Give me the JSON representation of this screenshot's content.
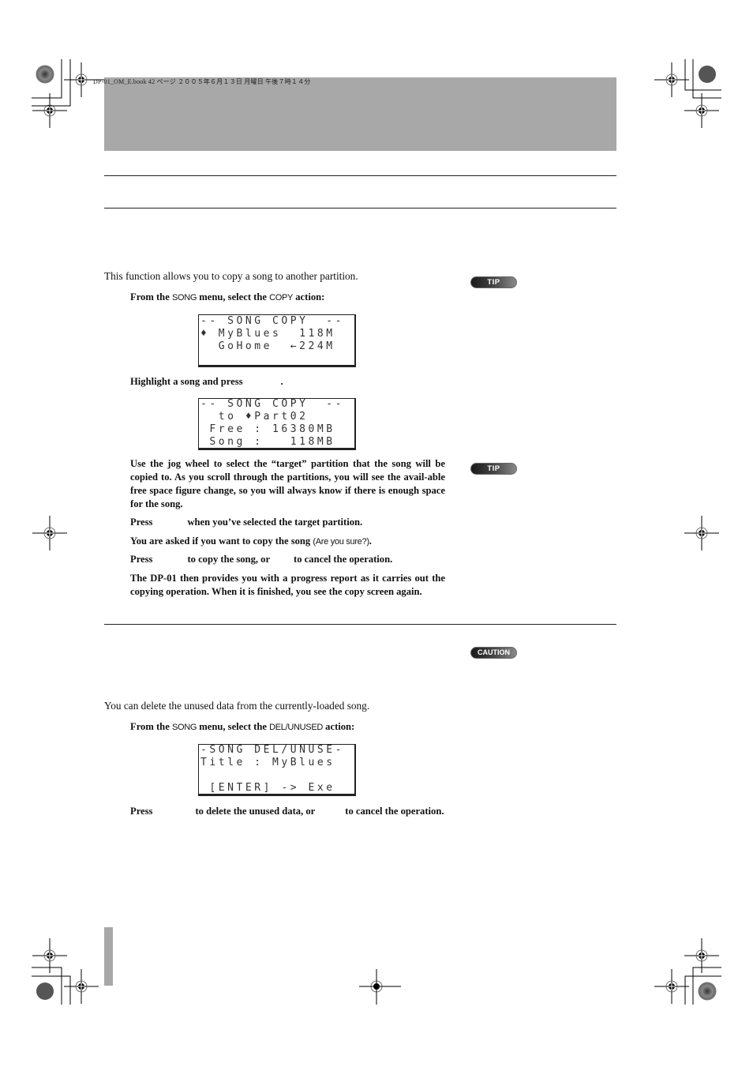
{
  "page": {
    "file_info": "DP-01_OM_E.book  42 ページ  ２００５年６月１３日  月曜日  午後７時１４分"
  },
  "badges": {
    "tip1": "TIP",
    "tip2": "TIP",
    "caution": "CAUTION"
  },
  "copy_section": {
    "intro": "This function allows you to copy a song to another partition.",
    "step1": {
      "pre": "From the ",
      "menu": "SONG",
      "mid": " menu, select the ",
      "action": "COPY",
      "post": " action:"
    },
    "lcd1": [
      "-- SONG COPY  --",
      "♦ MyBlues  118M",
      "  GoHome  ←224M"
    ],
    "step2": "Highlight a song and press",
    "step2_end": ".",
    "lcd2": [
      "-- SONG COPY  --",
      "  to ♦Part02",
      " Free : 16380MB",
      " Song :   118MB"
    ],
    "step3": "Use the jog wheel to select the “target” partition that the song will be copied to. As you scroll through the partitions, you will see the avail-able free space figure change, so you will always know if there is enough space for the song.",
    "step4_a": "Press",
    "step4_b": "when you’ve selected the target partition.",
    "step5_a": "You are asked if you want to copy the song ",
    "step5_prompt": "(Are you sure?)",
    "step5_b": ".",
    "step6_a": "Press",
    "step6_b": "to copy the song, or",
    "step6_c": "to cancel the operation.",
    "step7": "The DP-01 then provides you with a progress report as it carries out the copying operation. When it is finished, you see the copy screen again."
  },
  "delete_section": {
    "intro": "You can delete the unused data from the currently-loaded song.",
    "step1": {
      "pre": "From the ",
      "menu": "SONG",
      "mid": " menu, select the ",
      "action": "DEL/UNUSED",
      "post": " action:"
    },
    "lcd": [
      "-SONG DEL/UNUSE-",
      "Title : MyBlues",
      "",
      " [ENTER] -> Exe"
    ],
    "step2_a": "Press",
    "step2_b": "to delete the unused data, or",
    "step2_c": "to cancel the operation."
  }
}
